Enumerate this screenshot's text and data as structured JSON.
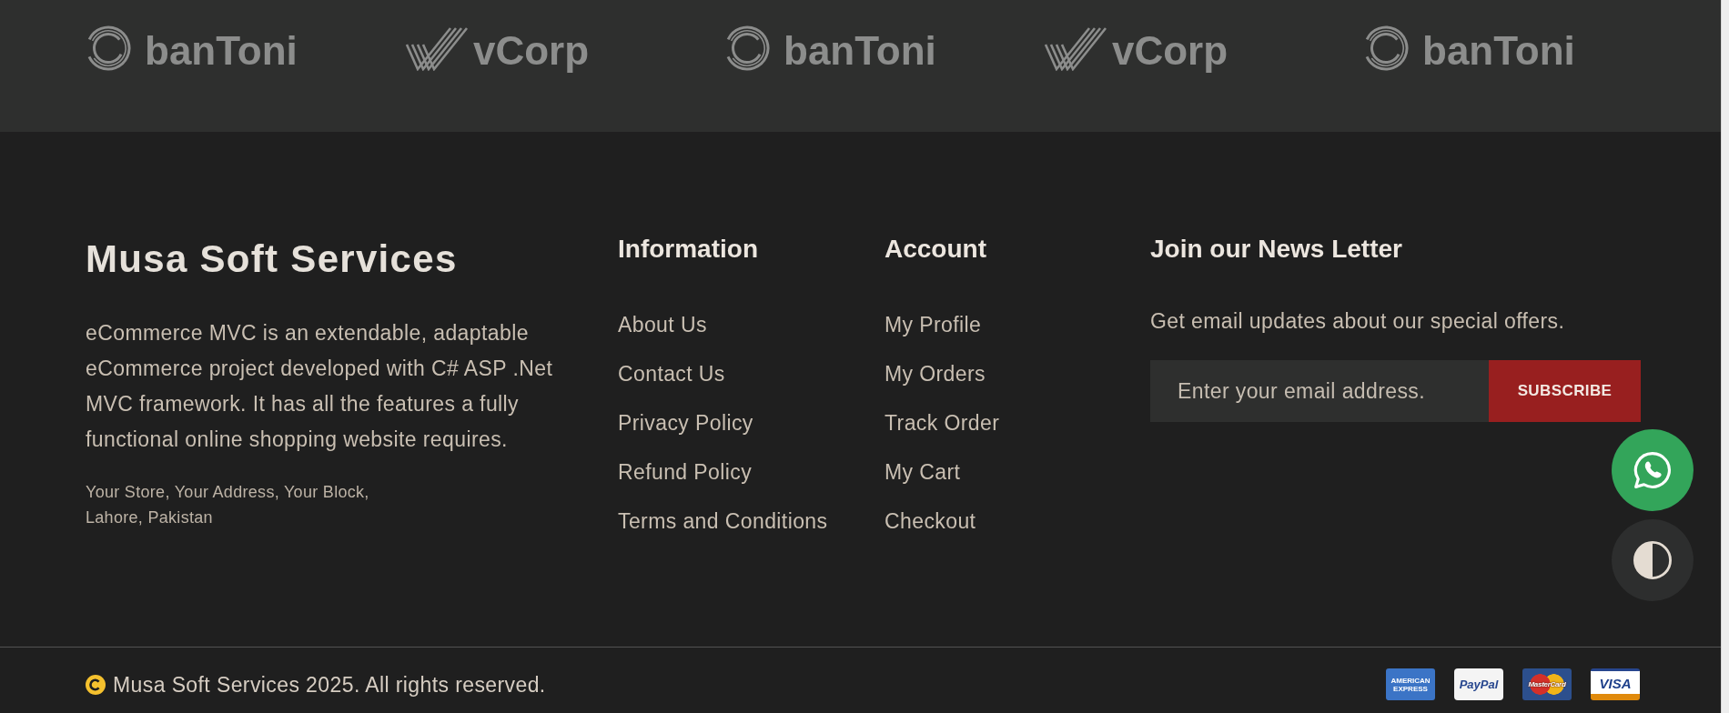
{
  "partner_logos": [
    {
      "name": "banToni",
      "kind": "rings"
    },
    {
      "name": "vCorp",
      "kind": "stripes"
    },
    {
      "name": "banToni",
      "kind": "rings"
    },
    {
      "name": "vCorp",
      "kind": "stripes"
    },
    {
      "name": "banToni",
      "kind": "rings"
    }
  ],
  "about": {
    "title": "Musa Soft Services",
    "description": "eCommerce MVC is an extendable, adaptable eCommerce project developed with C# ASP .Net MVC framework. It has all the features a fully functional online shopping website requires.",
    "address_lines": [
      "Your Store, Your Address, Your Block,",
      "Lahore, Pakistan"
    ]
  },
  "link_columns": [
    {
      "heading": "Information",
      "links": [
        "About Us",
        "Contact Us",
        "Privacy Policy",
        "Refund Policy",
        "Terms and Conditions"
      ]
    },
    {
      "heading": "Account",
      "links": [
        "My Profile",
        "My Orders",
        "Track Order",
        "My Cart",
        "Checkout"
      ]
    }
  ],
  "newsletter": {
    "heading": "Join our News Letter",
    "text": "Get email updates about our special offers.",
    "email_field": {
      "placeholder": "Enter your email address."
    },
    "button": "SUBSCRIBE"
  },
  "copyright": "Musa Soft Services 2025. All rights reserved.",
  "payment_methods": [
    {
      "kind": "amex",
      "label": "AMERICAN EXPRESS"
    },
    {
      "kind": "paypal",
      "label": "PayPal"
    },
    {
      "kind": "mastercard",
      "label": "MasterCard"
    },
    {
      "kind": "visa",
      "label": "VISA"
    }
  ]
}
